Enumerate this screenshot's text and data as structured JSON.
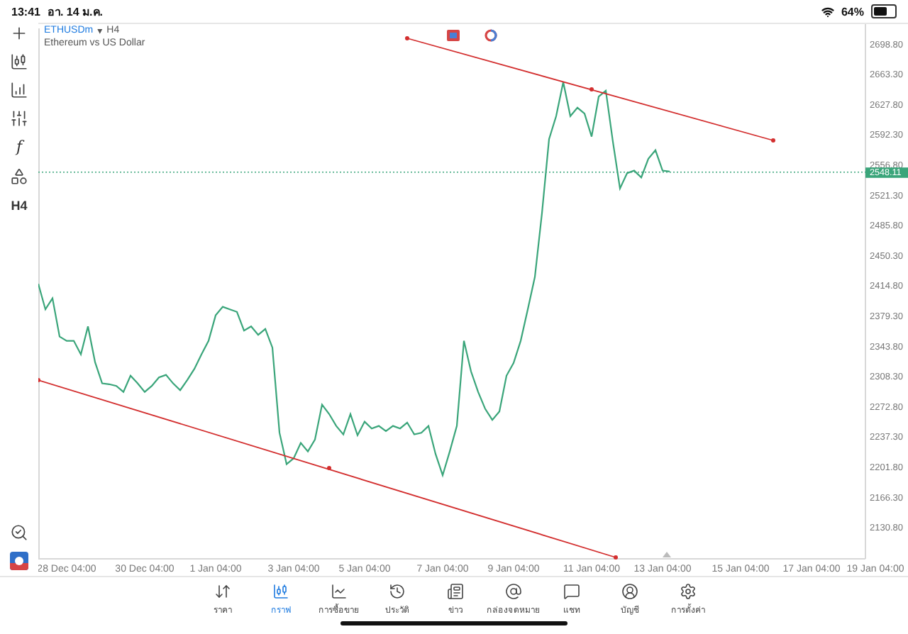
{
  "status_bar": {
    "time": "13:41",
    "date": "อา. 14 ม.ค.",
    "battery": "64%"
  },
  "toolbar": {
    "function_label": "f",
    "timeframe_label": "H4"
  },
  "chart": {
    "symbol": "ETHUSDm",
    "symbol_caret": "▾",
    "timeframe": "H4",
    "description": "Ethereum vs US Dollar",
    "last_price": "2548.11",
    "chart_data": {
      "type": "line",
      "ylim": [
        2093.8,
        2717.1
      ],
      "categories": [
        null,
        null,
        null,
        null,
        "28 Dec 04:00",
        null,
        null,
        null,
        null,
        null,
        null,
        null,
        null,
        null,
        null,
        "30 Dec 04:00",
        null,
        null,
        null,
        null,
        null,
        null,
        null,
        null,
        null,
        "1 Jan 04:00",
        null,
        null,
        null,
        null,
        null,
        null,
        null,
        null,
        null,
        null,
        "3 Jan 04:00",
        null,
        null,
        null,
        null,
        null,
        null,
        null,
        null,
        null,
        "5 Jan 04:00",
        null,
        null,
        null,
        null,
        null,
        null,
        null,
        null,
        null,
        null,
        "7 Jan 04:00",
        null,
        null,
        null,
        null,
        null,
        null,
        null,
        null,
        null,
        "9 Jan 04:00",
        null,
        null,
        null,
        null,
        null,
        null,
        null,
        null,
        null,
        null,
        "11 Jan 04:00",
        null,
        null,
        null,
        null,
        null,
        null,
        null,
        null,
        null,
        "13 Jan 04:00",
        null,
        null,
        null,
        null,
        null,
        null,
        null,
        null,
        null,
        null,
        "15 Jan 04:00",
        null,
        null,
        null,
        null,
        null,
        null,
        null,
        null,
        null,
        "17 Jan 04:00",
        null,
        null,
        null,
        null,
        null,
        null,
        null,
        null,
        "19 Jan 04:00",
        null
      ],
      "yticks": [
        {
          "value": 2698.8,
          "label": "2698.80"
        },
        {
          "value": 2663.3,
          "label": "2663.30"
        },
        {
          "value": 2627.8,
          "label": "2627.80"
        },
        {
          "value": 2592.3,
          "label": "2592.30"
        },
        {
          "value": 2556.8,
          "label": "2556.80"
        },
        {
          "value": 2521.3,
          "label": "2521.30"
        },
        {
          "value": 2485.8,
          "label": "2485.80"
        },
        {
          "value": 2450.3,
          "label": "2450.30"
        },
        {
          "value": 2414.8,
          "label": "2414.80"
        },
        {
          "value": 2379.3,
          "label": "2379.30"
        },
        {
          "value": 2343.8,
          "label": "2343.80"
        },
        {
          "value": 2308.3,
          "label": "2308.30"
        },
        {
          "value": 2272.8,
          "label": "2272.80"
        },
        {
          "value": 2237.3,
          "label": "2237.30"
        },
        {
          "value": 2201.8,
          "label": "2201.80"
        },
        {
          "value": 2166.3,
          "label": "2166.30"
        },
        {
          "value": 2130.8,
          "label": "2130.80"
        }
      ],
      "series": [
        {
          "color": "#3aa57a",
          "values": [
            2417,
            2387,
            2400,
            2355,
            2350,
            2350,
            2334,
            2367,
            2325,
            2300,
            2299,
            2297,
            2290,
            2309,
            2300,
            2290,
            2297,
            2307,
            2310,
            2300,
            2292,
            2304,
            2317,
            2334,
            2350,
            2380,
            2390,
            2387,
            2384,
            2362,
            2367,
            2357,
            2364,
            2342,
            2242,
            2205,
            2212,
            2230,
            2220,
            2234,
            2275,
            2264,
            2250,
            2240,
            2264,
            2239,
            2255,
            2247,
            2250,
            2244,
            2250,
            2247,
            2254,
            2240,
            2242,
            2250,
            2217,
            2192,
            2220,
            2250,
            2350,
            2314,
            2290,
            2270,
            2257,
            2267,
            2309,
            2324,
            2350,
            2387,
            2425,
            2500,
            2587,
            2614,
            2654,
            2614,
            2624,
            2617,
            2590,
            2637,
            2644,
            2584,
            2529,
            2547,
            2550,
            2542,
            2564,
            2574,
            2550,
            2549,
            null,
            null,
            null,
            null,
            null,
            null,
            null,
            null,
            null,
            null,
            null,
            null,
            null,
            null,
            null,
            null,
            null,
            null,
            null,
            null,
            null,
            null,
            null,
            null,
            null,
            null,
            null,
            null,
            null,
            null
          ]
        }
      ]
    }
  },
  "tabs": [
    {
      "label": "ราคา",
      "selected": false
    },
    {
      "label": "กราฟ",
      "selected": true
    },
    {
      "label": "การซื้อขาย",
      "selected": false
    },
    {
      "label": "ประวัติ",
      "selected": false
    },
    {
      "label": "ข่าว",
      "selected": false
    },
    {
      "label": "กล่องจดหมาย",
      "selected": false
    },
    {
      "label": "แชท",
      "selected": false
    },
    {
      "label": "บัญชี",
      "selected": false
    },
    {
      "label": "การตั้งค่า",
      "selected": false
    }
  ]
}
